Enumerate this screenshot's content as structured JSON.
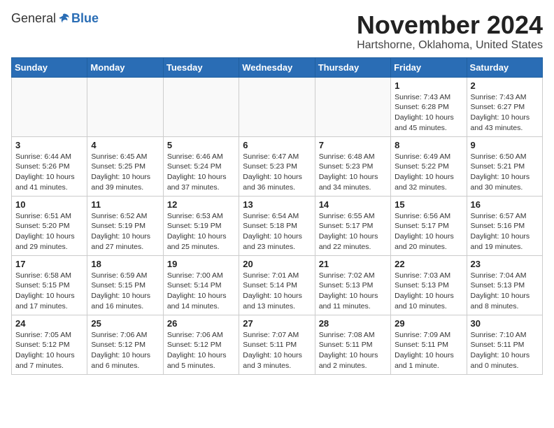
{
  "header": {
    "logo_general": "General",
    "logo_blue": "Blue",
    "month_title": "November 2024",
    "location": "Hartshorne, Oklahoma, United States"
  },
  "days_of_week": [
    "Sunday",
    "Monday",
    "Tuesday",
    "Wednesday",
    "Thursday",
    "Friday",
    "Saturday"
  ],
  "weeks": [
    [
      {
        "day": "",
        "info": ""
      },
      {
        "day": "",
        "info": ""
      },
      {
        "day": "",
        "info": ""
      },
      {
        "day": "",
        "info": ""
      },
      {
        "day": "",
        "info": ""
      },
      {
        "day": "1",
        "info": "Sunrise: 7:43 AM\nSunset: 6:28 PM\nDaylight: 10 hours\nand 45 minutes."
      },
      {
        "day": "2",
        "info": "Sunrise: 7:43 AM\nSunset: 6:27 PM\nDaylight: 10 hours\nand 43 minutes."
      }
    ],
    [
      {
        "day": "3",
        "info": "Sunrise: 6:44 AM\nSunset: 5:26 PM\nDaylight: 10 hours\nand 41 minutes."
      },
      {
        "day": "4",
        "info": "Sunrise: 6:45 AM\nSunset: 5:25 PM\nDaylight: 10 hours\nand 39 minutes."
      },
      {
        "day": "5",
        "info": "Sunrise: 6:46 AM\nSunset: 5:24 PM\nDaylight: 10 hours\nand 37 minutes."
      },
      {
        "day": "6",
        "info": "Sunrise: 6:47 AM\nSunset: 5:23 PM\nDaylight: 10 hours\nand 36 minutes."
      },
      {
        "day": "7",
        "info": "Sunrise: 6:48 AM\nSunset: 5:23 PM\nDaylight: 10 hours\nand 34 minutes."
      },
      {
        "day": "8",
        "info": "Sunrise: 6:49 AM\nSunset: 5:22 PM\nDaylight: 10 hours\nand 32 minutes."
      },
      {
        "day": "9",
        "info": "Sunrise: 6:50 AM\nSunset: 5:21 PM\nDaylight: 10 hours\nand 30 minutes."
      }
    ],
    [
      {
        "day": "10",
        "info": "Sunrise: 6:51 AM\nSunset: 5:20 PM\nDaylight: 10 hours\nand 29 minutes."
      },
      {
        "day": "11",
        "info": "Sunrise: 6:52 AM\nSunset: 5:19 PM\nDaylight: 10 hours\nand 27 minutes."
      },
      {
        "day": "12",
        "info": "Sunrise: 6:53 AM\nSunset: 5:19 PM\nDaylight: 10 hours\nand 25 minutes."
      },
      {
        "day": "13",
        "info": "Sunrise: 6:54 AM\nSunset: 5:18 PM\nDaylight: 10 hours\nand 23 minutes."
      },
      {
        "day": "14",
        "info": "Sunrise: 6:55 AM\nSunset: 5:17 PM\nDaylight: 10 hours\nand 22 minutes."
      },
      {
        "day": "15",
        "info": "Sunrise: 6:56 AM\nSunset: 5:17 PM\nDaylight: 10 hours\nand 20 minutes."
      },
      {
        "day": "16",
        "info": "Sunrise: 6:57 AM\nSunset: 5:16 PM\nDaylight: 10 hours\nand 19 minutes."
      }
    ],
    [
      {
        "day": "17",
        "info": "Sunrise: 6:58 AM\nSunset: 5:15 PM\nDaylight: 10 hours\nand 17 minutes."
      },
      {
        "day": "18",
        "info": "Sunrise: 6:59 AM\nSunset: 5:15 PM\nDaylight: 10 hours\nand 16 minutes."
      },
      {
        "day": "19",
        "info": "Sunrise: 7:00 AM\nSunset: 5:14 PM\nDaylight: 10 hours\nand 14 minutes."
      },
      {
        "day": "20",
        "info": "Sunrise: 7:01 AM\nSunset: 5:14 PM\nDaylight: 10 hours\nand 13 minutes."
      },
      {
        "day": "21",
        "info": "Sunrise: 7:02 AM\nSunset: 5:13 PM\nDaylight: 10 hours\nand 11 minutes."
      },
      {
        "day": "22",
        "info": "Sunrise: 7:03 AM\nSunset: 5:13 PM\nDaylight: 10 hours\nand 10 minutes."
      },
      {
        "day": "23",
        "info": "Sunrise: 7:04 AM\nSunset: 5:13 PM\nDaylight: 10 hours\nand 8 minutes."
      }
    ],
    [
      {
        "day": "24",
        "info": "Sunrise: 7:05 AM\nSunset: 5:12 PM\nDaylight: 10 hours\nand 7 minutes."
      },
      {
        "day": "25",
        "info": "Sunrise: 7:06 AM\nSunset: 5:12 PM\nDaylight: 10 hours\nand 6 minutes."
      },
      {
        "day": "26",
        "info": "Sunrise: 7:06 AM\nSunset: 5:12 PM\nDaylight: 10 hours\nand 5 minutes."
      },
      {
        "day": "27",
        "info": "Sunrise: 7:07 AM\nSunset: 5:11 PM\nDaylight: 10 hours\nand 3 minutes."
      },
      {
        "day": "28",
        "info": "Sunrise: 7:08 AM\nSunset: 5:11 PM\nDaylight: 10 hours\nand 2 minutes."
      },
      {
        "day": "29",
        "info": "Sunrise: 7:09 AM\nSunset: 5:11 PM\nDaylight: 10 hours\nand 1 minute."
      },
      {
        "day": "30",
        "info": "Sunrise: 7:10 AM\nSunset: 5:11 PM\nDaylight: 10 hours\nand 0 minutes."
      }
    ]
  ]
}
